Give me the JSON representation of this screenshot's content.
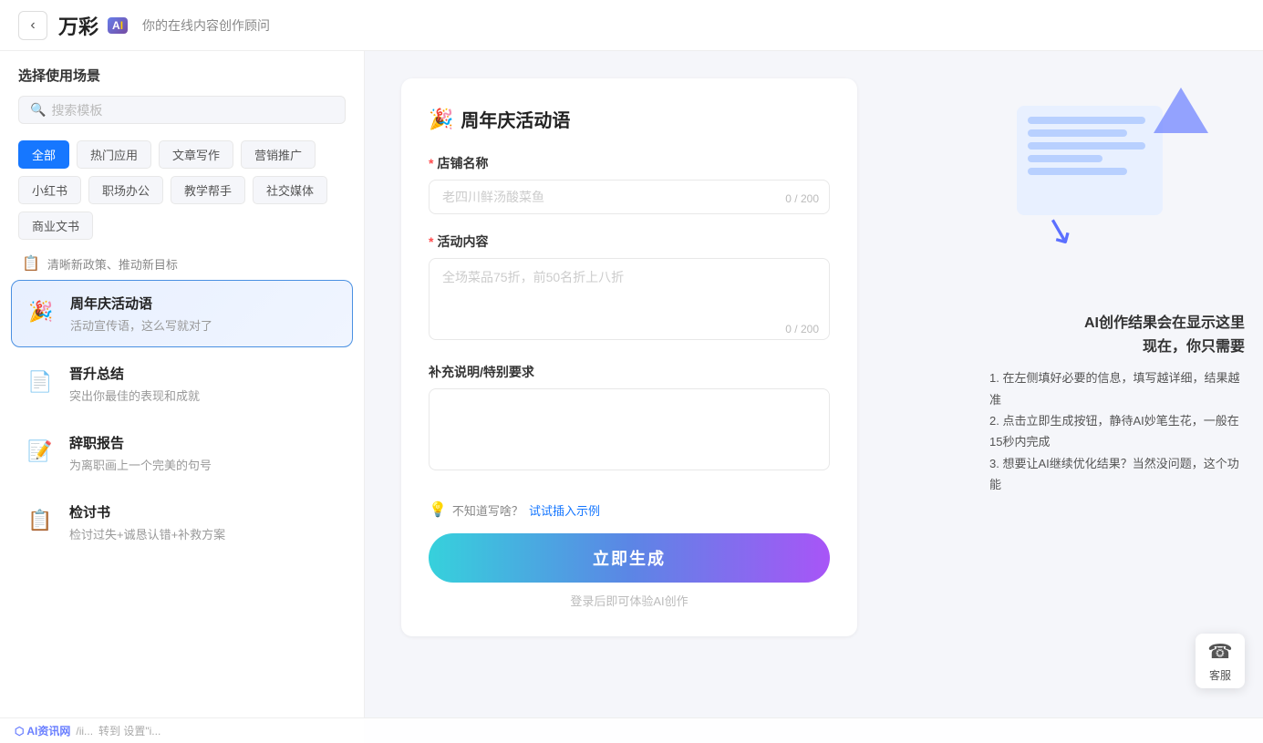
{
  "header": {
    "back_label": "‹",
    "logo_text": "万彩",
    "logo_ai": "AI",
    "subtitle": "你的在线内容创作顾问"
  },
  "sidebar": {
    "title": "选择使用场景",
    "search_placeholder": "搜索模板",
    "categories": [
      {
        "id": "all",
        "label": "全部",
        "active": true
      },
      {
        "id": "hot",
        "label": "热门应用",
        "active": false
      },
      {
        "id": "article",
        "label": "文章写作",
        "active": false
      },
      {
        "id": "marketing",
        "label": "营销推广",
        "active": false
      },
      {
        "id": "xiaohongshu",
        "label": "小红书",
        "active": false
      },
      {
        "id": "office",
        "label": "职场办公",
        "active": false
      },
      {
        "id": "teaching",
        "label": "教学帮手",
        "active": false
      },
      {
        "id": "social",
        "label": "社交媒体",
        "active": false
      },
      {
        "id": "business",
        "label": "商业文书",
        "active": false
      }
    ],
    "policy_item": {
      "icon": "📋",
      "text": "清晰新政策、推动新目标"
    },
    "templates": [
      {
        "id": "anniversary",
        "icon": "🎉",
        "name": "周年庆活动语",
        "desc": "活动宣传语，这么写就对了",
        "active": true
      },
      {
        "id": "promotion",
        "icon": "📄",
        "name": "晋升总结",
        "desc": "突出你最佳的表现和成就",
        "active": false
      },
      {
        "id": "resignation",
        "icon": "📝",
        "name": "辞职报告",
        "desc": "为离职画上一个完美的句号",
        "active": false
      },
      {
        "id": "review",
        "icon": "📋",
        "name": "检讨书",
        "desc": "检讨过失+诚恳认错+补救方案",
        "active": false
      }
    ]
  },
  "form": {
    "title": "周年庆活动语",
    "title_icon": "🎉",
    "fields": [
      {
        "id": "shop_name",
        "label": "店铺名称",
        "required": true,
        "type": "input",
        "placeholder": "老四川鲜汤酸菜鱼",
        "value": "",
        "max": 200,
        "current": 0
      },
      {
        "id": "activity_content",
        "label": "活动内容",
        "required": true,
        "type": "textarea",
        "placeholder": "全场菜品75折，前50名折上八折",
        "value": "",
        "max": 200,
        "current": 0
      },
      {
        "id": "supplement",
        "label": "补充说明/特别要求",
        "required": false,
        "type": "textarea",
        "placeholder": "",
        "value": "",
        "max": null,
        "current": null
      }
    ],
    "hint": {
      "icon": "💡",
      "text": "不知道写啥？试试插入示例"
    },
    "generate_btn": "立即生成",
    "login_hint": "登录后即可体验AI创作"
  },
  "ai_preview": {
    "title_line1": "AI创作结果会在显示这里",
    "title_line2": "现在，你只需要",
    "steps": [
      "1. 在左侧填好必要的信息，填写越详细，结果越准",
      "2. 点击立即生成按钮，静待AI妙笔生花，一般在15秒内完成",
      "3. 想要让AI继续优化结果？当然没问题，这个功能"
    ]
  },
  "customer_service": {
    "icon": "☎",
    "label": "客服"
  },
  "bottom_bar": {
    "logo": "AI资讯网",
    "text": "转到 设置\"i..."
  }
}
